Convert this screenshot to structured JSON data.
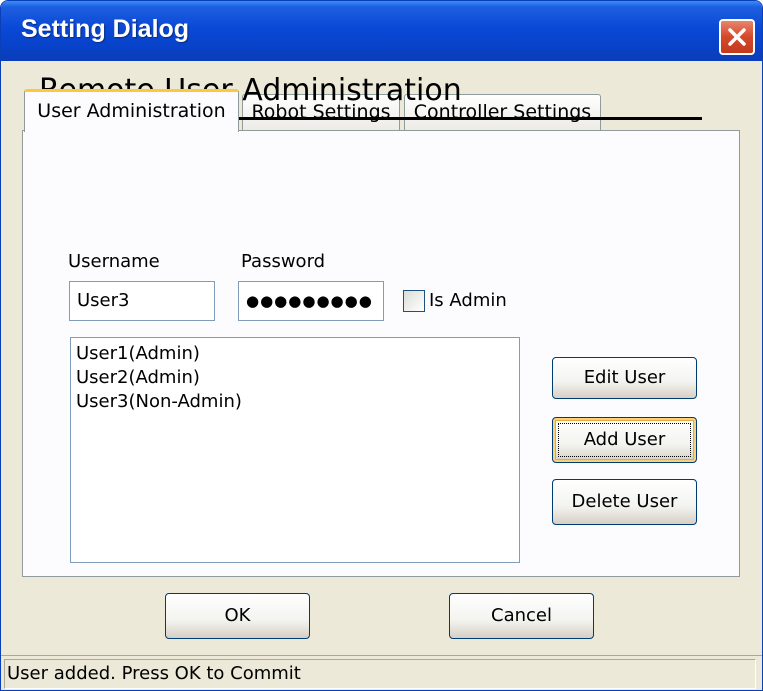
{
  "window": {
    "title": "Setting Dialog"
  },
  "tabs": [
    {
      "label": "User Administration",
      "active": true
    },
    {
      "label": "Robot Settings",
      "active": false
    },
    {
      "label": "Controller Settings",
      "active": false
    }
  ],
  "panel": {
    "title": "Remote User Administration",
    "username_label": "Username",
    "username_value": "User3",
    "password_label": "Password",
    "password_value": "●●●●●●●●●",
    "is_admin_label": "Is Admin",
    "is_admin_checked": false,
    "users": [
      "User1(Admin)",
      "User2(Admin)",
      "User3(Non-Admin)"
    ]
  },
  "actions": {
    "edit_user": "Edit User",
    "add_user": "Add User",
    "delete_user": "Delete User"
  },
  "footer": {
    "ok": "OK",
    "cancel": "Cancel"
  },
  "status": {
    "message": "User added. Press OK to Commit"
  },
  "colors": {
    "titlebar": "#0a48d6",
    "close_button": "#d4492a",
    "active_tab_accent": "#ffc83c",
    "dialog_bg": "#ece9d8"
  },
  "icons": {
    "close": "close-icon"
  }
}
